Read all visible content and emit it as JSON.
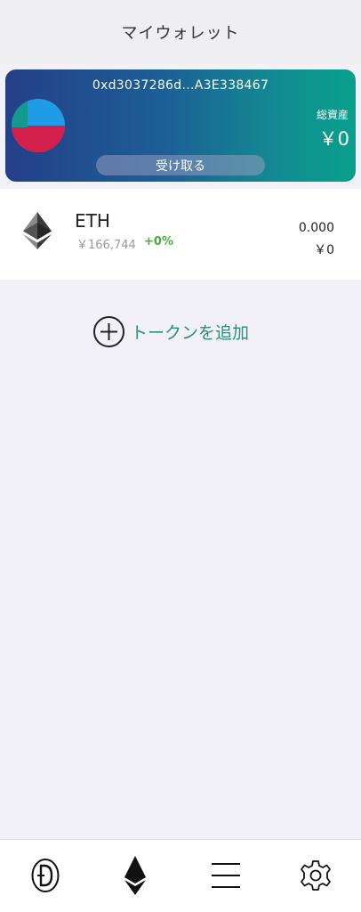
{
  "header": {
    "title": "マイウォレット"
  },
  "wallet_card": {
    "address": "0xd3037286d...A3E338467",
    "total_label": "総資産",
    "total_value": "￥0",
    "receive_label": "受け取る"
  },
  "tokens": [
    {
      "symbol": "ETH",
      "price": "￥166,744",
      "change": "+0%",
      "amount": "0.000",
      "value": "￥0",
      "icon": "ethereum-icon"
    }
  ],
  "add_token": {
    "label": "トークンを追加",
    "icon": "plus-circle-icon"
  },
  "tabbar": {
    "items": [
      {
        "icon": "dapp-icon"
      },
      {
        "icon": "ethereum-icon"
      },
      {
        "icon": "menu-icon"
      },
      {
        "icon": "gear-icon"
      }
    ]
  },
  "colors": {
    "accent": "#2b8f7e",
    "change_positive": "#4aaa3e",
    "card_gradient_start": "#243f88",
    "card_gradient_end": "#08a08a"
  }
}
